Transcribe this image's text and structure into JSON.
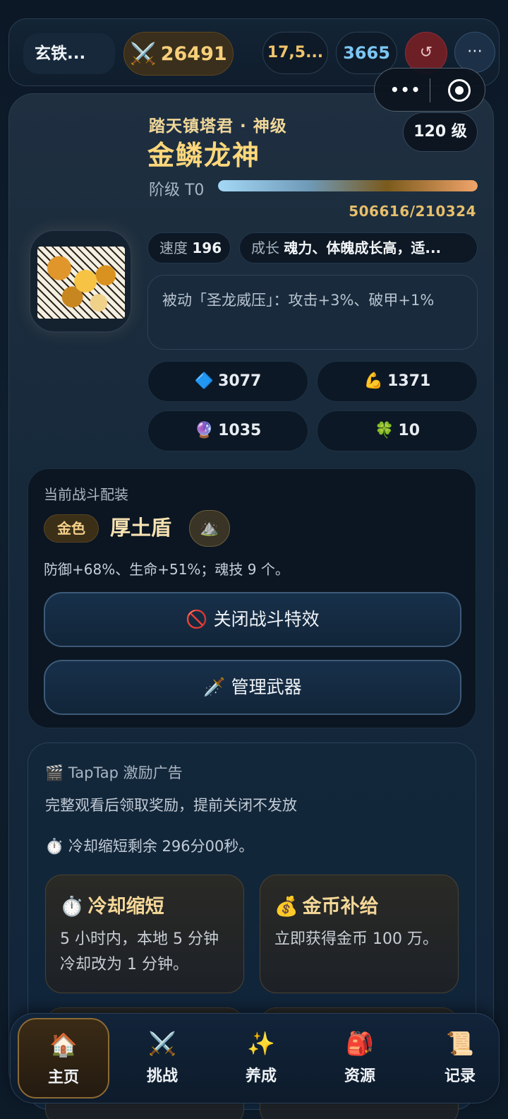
{
  "topbar": {
    "name": "玄铁...",
    "power_icon": "⚔️",
    "power": "26491",
    "gold": "17,5...",
    "gems": "3665",
    "refresh_icon": "↺",
    "more_icon": "⋯"
  },
  "capsule": {
    "menu_icon": "•••",
    "close_icon": "target"
  },
  "hero": {
    "subtitle": "踏天镇塔君 · 神级",
    "name": "金鳞龙神",
    "level": "120 级",
    "tier_label": "阶级 T0",
    "tier_progress": 1.0,
    "exp": "506616/210324",
    "speed_label": "速度",
    "speed": "196",
    "growth_label": "成长",
    "growth": "魂力、体魄成长高，适...",
    "passive": "被动「圣龙威压」：攻击+3%、破甲+1%",
    "stats": [
      {
        "icon": "🔷",
        "value": "3077"
      },
      {
        "icon": "💪",
        "value": "1371"
      },
      {
        "icon": "🔮",
        "value": "1035"
      },
      {
        "icon": "🍀",
        "value": "10"
      }
    ]
  },
  "equipment": {
    "title": "当前战斗配装",
    "rarity": "金色",
    "name": "厚土盾",
    "icon": "⛰️",
    "desc": "防御+68%、生命+51%；魂技 9 个。",
    "btn_effects_icon": "🚫",
    "btn_effects": "关闭战斗特效",
    "btn_weapons_icon": "🗡️",
    "btn_weapons": "管理武器"
  },
  "ad": {
    "title_icon": "🎬",
    "title": "TapTap 激励广告",
    "desc": "完整观看后领取奖励，提前关闭不发放",
    "cooldown_icon": "⏱️",
    "cooldown": "冷却缩短剩余 296分00秒。",
    "cards": [
      {
        "icon": "⏱️",
        "title": "冷却缩短",
        "body": "5 小时内，本地 5 分钟冷却改为 1 分钟。"
      },
      {
        "icon": "💰",
        "title": "金币补给",
        "body": "立即获得金币 100 万。"
      }
    ]
  },
  "nav": [
    {
      "icon": "🏠",
      "label": "主页"
    },
    {
      "icon": "⚔️",
      "label": "挑战"
    },
    {
      "icon": "✨",
      "label": "养成"
    },
    {
      "icon": "🎒",
      "label": "资源"
    },
    {
      "icon": "📜",
      "label": "记录"
    }
  ]
}
